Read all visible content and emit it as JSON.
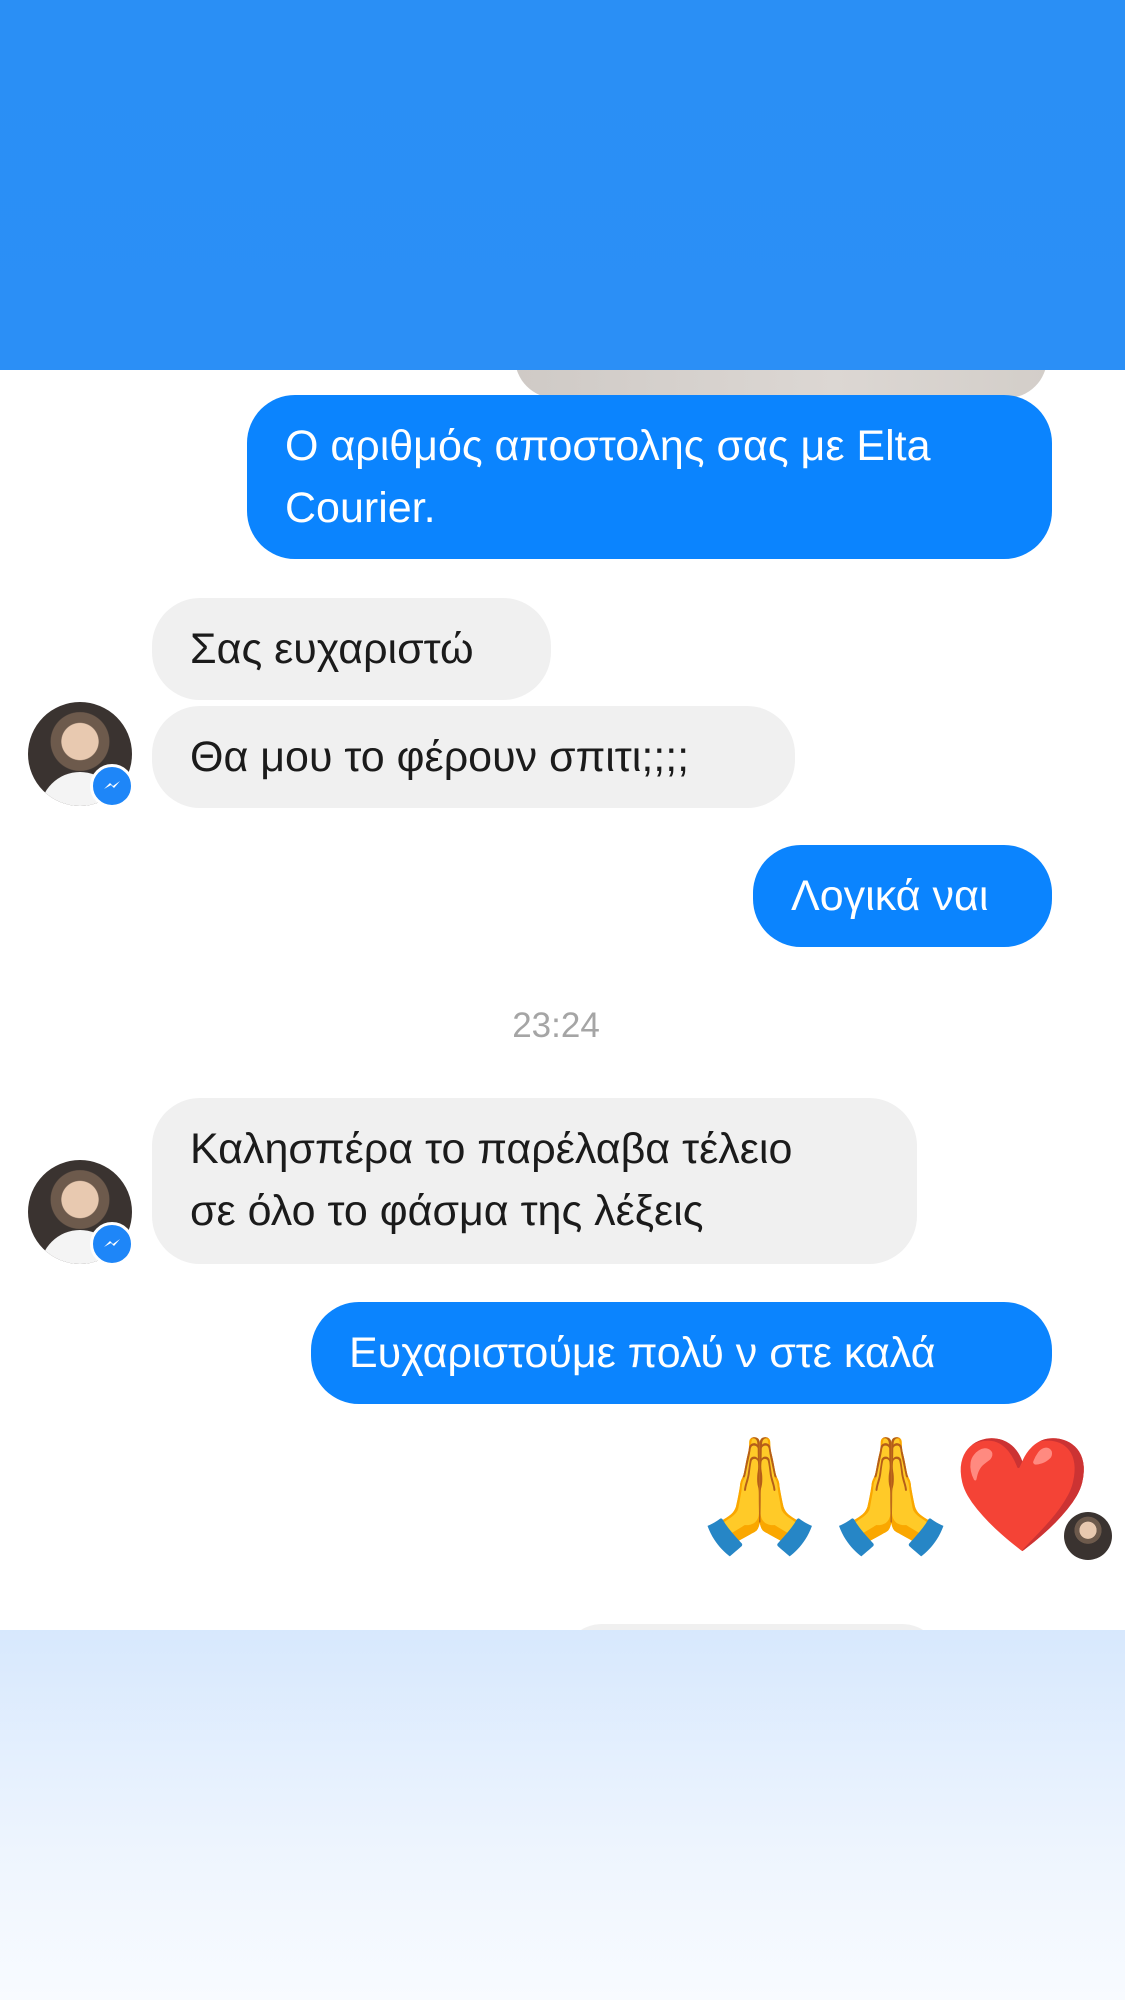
{
  "messages": {
    "m1": {
      "lines": [
        "Ο αριθμός αποστολης σας με Elta",
        "Courier."
      ]
    },
    "m2": {
      "text": "Σας ευχαριστώ"
    },
    "m3": {
      "text": "Θα μου το φέρουν σπιτι;;;;"
    },
    "m4": {
      "text": "Λογικά ναι"
    },
    "m5": {
      "lines": [
        "Καλησπέρα το παρέλαβα τέλειο",
        "σε όλο το φάσμα της λέξεις"
      ]
    },
    "m6": {
      "text": "Ευχαριστούμε πολύ ν στε καλά"
    },
    "m7": {
      "text": "🙏🙏❤️"
    }
  },
  "timestamp": "23:24",
  "icons": {
    "avatar": "user-avatar-icon",
    "badge": "messenger-icon",
    "read_receipt": "read-receipt-avatar-icon"
  },
  "colors": {
    "outgoing_bubble": "#0b84fe",
    "incoming_bubble": "#f0f0f0",
    "header": "#2a8ff5"
  }
}
